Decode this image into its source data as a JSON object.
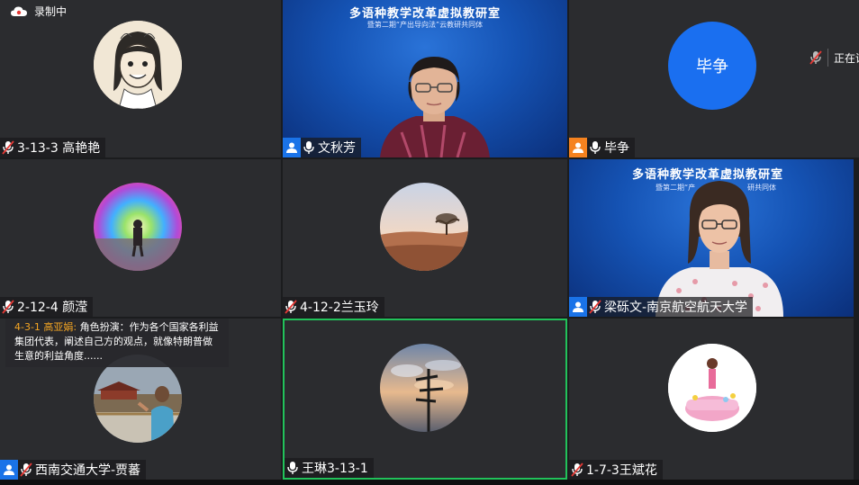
{
  "recording": {
    "label": "录制中",
    "icon": "cloud-record-icon"
  },
  "status_right": {
    "label": "正在讲",
    "icon": "mic-muted-icon"
  },
  "chat_popup": {
    "sender": "4-3-1 高亚娟:",
    "message": "角色扮演：作为各个国家各利益集团代表，阐述自己方的观点，就像特朗普做生意的利益角度......"
  },
  "conference_banner": {
    "title": "多语种教学改革虚拟教研室",
    "subtitle": "暨第二期“产出导向法”云教研共同体",
    "subtitle_partial": "暨第二期“产",
    "subtitle_tail": "研共同体"
  },
  "tiles": [
    {
      "name": "3-13-3 高艳艳",
      "mic": "muted",
      "badge": ""
    },
    {
      "name": "文秋芳",
      "mic": "on",
      "badge": "host"
    },
    {
      "name": "毕争",
      "mic": "on",
      "badge": "cohost",
      "avatar_text": "毕争"
    },
    {
      "name": "2-12-4 颜滢",
      "mic": "muted",
      "badge": ""
    },
    {
      "name": "4-12-2兰玉玲",
      "mic": "muted",
      "badge": ""
    },
    {
      "name": "梁砾文-南京航空航天大学",
      "mic": "muted",
      "badge": "host"
    },
    {
      "name": "西南交通大学-贾蕃",
      "mic": "muted",
      "badge": "host"
    },
    {
      "name": "王琳3-13-1",
      "mic": "on",
      "badge": "",
      "active": true
    },
    {
      "name": "1-7-3王斌花",
      "mic": "muted",
      "badge": ""
    }
  ],
  "colors": {
    "active_border": "#21c25a",
    "host_badge": "#1a73e8",
    "cohost_badge": "#f5821f",
    "avatar_blue": "#1a6ff0",
    "chat_sender": "#f5a623"
  }
}
